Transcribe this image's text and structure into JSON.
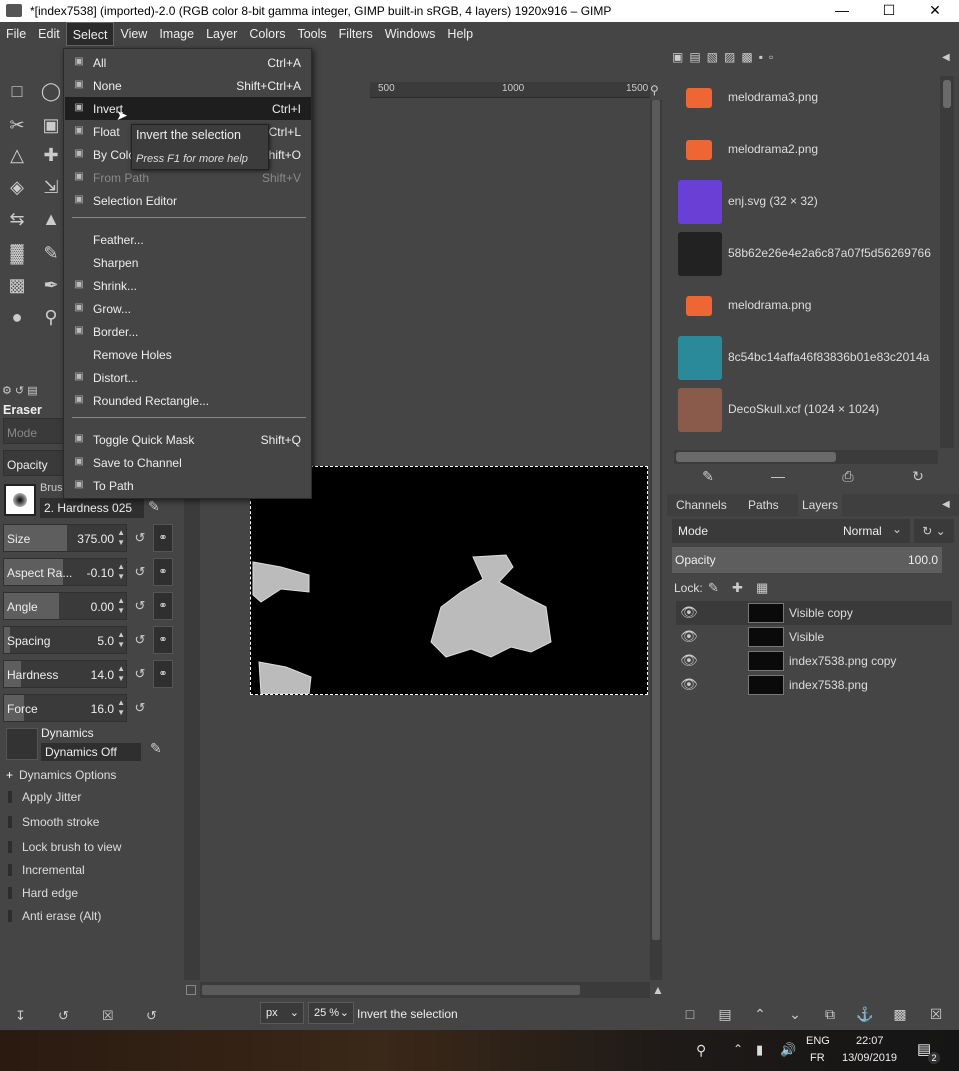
{
  "window": {
    "title": "*[index7538] (imported)-2.0 (RGB color 8-bit gamma integer, GIMP built-in sRGB, 4 layers) 1920x916 – GIMP",
    "min_icon": "minimize-icon",
    "max_icon": "maximize-icon",
    "close_icon": "close-icon"
  },
  "menubar": [
    "File",
    "Edit",
    "Select",
    "View",
    "Image",
    "Layer",
    "Colors",
    "Tools",
    "Filters",
    "Windows",
    "Help"
  ],
  "select_menu": {
    "items": [
      {
        "label": "All",
        "shortcut": "Ctrl+A",
        "icon": "select-all-icon"
      },
      {
        "label": "None",
        "shortcut": "Shift+Ctrl+A",
        "icon": "select-none-icon"
      },
      {
        "label": "Invert",
        "shortcut": "Ctrl+I",
        "icon": "invert-icon"
      },
      {
        "label": "Float",
        "shortcut": "Shift+Ctrl+L",
        "icon": "float-icon"
      },
      {
        "label": "By Color",
        "shortcut": "Shift+O",
        "icon": "by-color-icon"
      },
      {
        "label": "From Path",
        "shortcut": "Shift+V",
        "icon": "from-path-icon"
      },
      {
        "label": "Selection Editor",
        "shortcut": "",
        "icon": "selection-editor-icon"
      },
      {
        "label": "Feather...",
        "shortcut": "",
        "icon": ""
      },
      {
        "label": "Sharpen",
        "shortcut": "",
        "icon": ""
      },
      {
        "label": "Shrink...",
        "shortcut": "",
        "icon": "shrink-icon"
      },
      {
        "label": "Grow...",
        "shortcut": "",
        "icon": "grow-icon"
      },
      {
        "label": "Border...",
        "shortcut": "",
        "icon": "border-icon"
      },
      {
        "label": "Remove Holes",
        "shortcut": "",
        "icon": ""
      },
      {
        "label": "Distort...",
        "shortcut": "",
        "icon": "distort-icon"
      },
      {
        "label": "Rounded Rectangle...",
        "shortcut": "",
        "icon": "rounded-rectangle-icon"
      },
      {
        "label": "Toggle Quick Mask",
        "shortcut": "Shift+Q",
        "icon": "quick-mask-icon"
      },
      {
        "label": "Save to Channel",
        "shortcut": "",
        "icon": "save-channel-icon"
      },
      {
        "label": "To Path",
        "shortcut": "",
        "icon": "to-path-icon"
      }
    ]
  },
  "tooltip": {
    "title": "Invert the selection",
    "help": "Press F1 for more help"
  },
  "tool_options": {
    "tool_name": "Eraser",
    "mode_label": "Mode",
    "opacity_label": "Opacity",
    "brush_label": "Brush",
    "brush_name": "2. Hardness 025",
    "sliders": [
      {
        "label": "Size",
        "value": "375.00",
        "fill": 0.52
      },
      {
        "label": "Aspect Ra...",
        "value": "-0.10",
        "fill": 0.48
      },
      {
        "label": "Angle",
        "value": "0.00",
        "fill": 0.45
      },
      {
        "label": "Spacing",
        "value": "5.0",
        "fill": 0.05
      },
      {
        "label": "Hardness",
        "value": "14.0",
        "fill": 0.14
      },
      {
        "label": "Force",
        "value": "16.0",
        "fill": 0.16
      }
    ],
    "dynamics_label": "Dynamics",
    "dynamics_value": "Dynamics Off",
    "checkboxes": [
      "Dynamics Options",
      "Apply Jitter",
      "Smooth stroke",
      "Lock brush to view",
      "Incremental",
      "Hard edge",
      "Anti erase  (Alt)"
    ]
  },
  "ruler": {
    "marks": [
      "500",
      "1000",
      "1500"
    ]
  },
  "status": {
    "unit": "px",
    "zoom": "25 %",
    "message": "Invert the selection"
  },
  "images": [
    {
      "name": "melodrama3.png",
      "color": "#e63"
    },
    {
      "name": "melodrama2.png",
      "color": "#e63"
    },
    {
      "name": "enj.svg (32 × 32)",
      "color": "#6a3fd6"
    },
    {
      "name": "58b62e26e4e2a6c87a07f5d56269766",
      "color": "#222"
    },
    {
      "name": "melodrama.png",
      "color": "#e63"
    },
    {
      "name": "8c54bc14affa46f83836b01e83c2014a",
      "color": "#2a8a9a"
    },
    {
      "name": "DecoSkull.xcf (1024 × 1024)",
      "color": "#8a5a4a"
    }
  ],
  "layers_panel": {
    "tabs": [
      "Channels",
      "Paths",
      "Layers"
    ],
    "mode_label": "Mode",
    "mode_value": "Normal",
    "opacity_label": "Opacity",
    "opacity_value": "100.0",
    "lock_label": "Lock:",
    "layers": [
      "Visible copy",
      "Visible",
      "index7538.png copy",
      "index7538.png"
    ]
  },
  "taskbar": {
    "lang1": "ENG",
    "lang2": "FR",
    "time": "22:07",
    "date": "13/09/2019",
    "notif_count": "2"
  }
}
